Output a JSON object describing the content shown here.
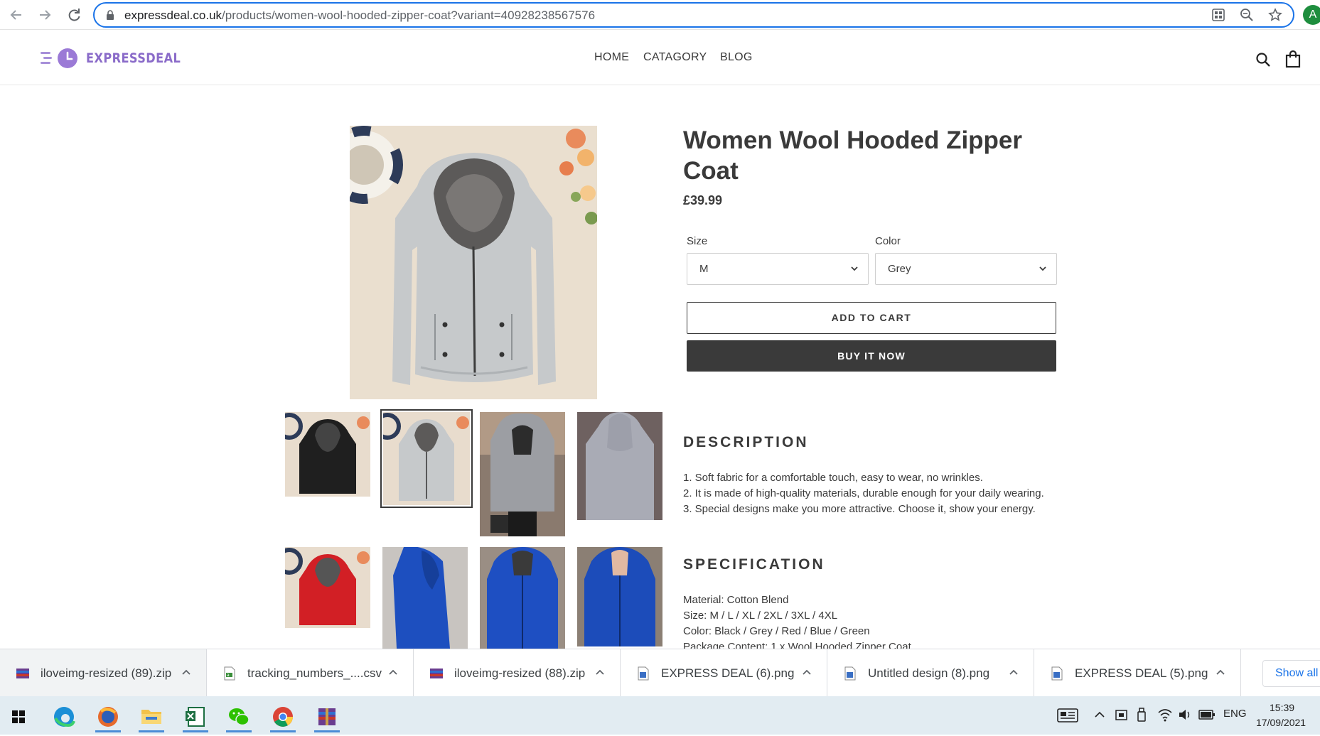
{
  "browser": {
    "url_domain": "expressdeal.co.uk",
    "url_path": "/products/women-wool-hooded-zipper-coat?variant=40928238567576",
    "profile_initial": "A"
  },
  "site": {
    "logo_text": "EXPRESSDEAL",
    "nav": [
      "HOME",
      "CATAGORY",
      "BLOG"
    ]
  },
  "product": {
    "title": "Women Wool Hooded Zipper Coat",
    "price": "£39.99",
    "size_label": "Size",
    "size_value": "M",
    "color_label": "Color",
    "color_value": "Grey",
    "add_to_cart": "ADD TO CART",
    "buy_now": "BUY IT NOW",
    "description_heading": "DESCRIPTION",
    "description_lines": [
      "1. Soft fabric for a comfortable touch, easy to wear, no wrinkles.",
      "2. It is made of high-quality materials, durable enough for your daily wearing.",
      "3. Special designs make you more attractive. Choose it, show your energy."
    ],
    "specification_heading": "SPECIFICATION",
    "specification_lines": [
      "Material: Cotton Blend",
      "Size: M / L / XL / 2XL / 3XL / 4XL",
      "Color: Black / Grey / Red / Blue / Green",
      "Package Content: 1 x Wool Hooded Zipper Coat"
    ],
    "thumbnails": [
      "black hoodie",
      "grey hoodie",
      "grey coat worn",
      "grey coat back",
      "red hoodie",
      "blue coat side",
      "blue coat front",
      "blue coat front 2"
    ],
    "selected_thumbnail": 1
  },
  "downloads": {
    "items": [
      {
        "name": "iloveimg-resized (89).zip",
        "icon": "archive-icon"
      },
      {
        "name": "tracking_numbers_....csv",
        "icon": "csv-icon"
      },
      {
        "name": "iloveimg-resized (88).zip",
        "icon": "archive-icon"
      },
      {
        "name": "EXPRESS DEAL (6).png",
        "icon": "image-file-icon"
      },
      {
        "name": "Untitled design (8).png",
        "icon": "image-file-icon"
      },
      {
        "name": "EXPRESS DEAL (5).png",
        "icon": "image-file-icon"
      }
    ],
    "show_all": "Show all"
  },
  "taskbar": {
    "language": "ENG",
    "time": "15:39",
    "date": "17/09/2021"
  },
  "colors": {
    "accent": "#1a73e8",
    "brand": "#8a6bc9",
    "dark_button": "#3a3a3a"
  }
}
